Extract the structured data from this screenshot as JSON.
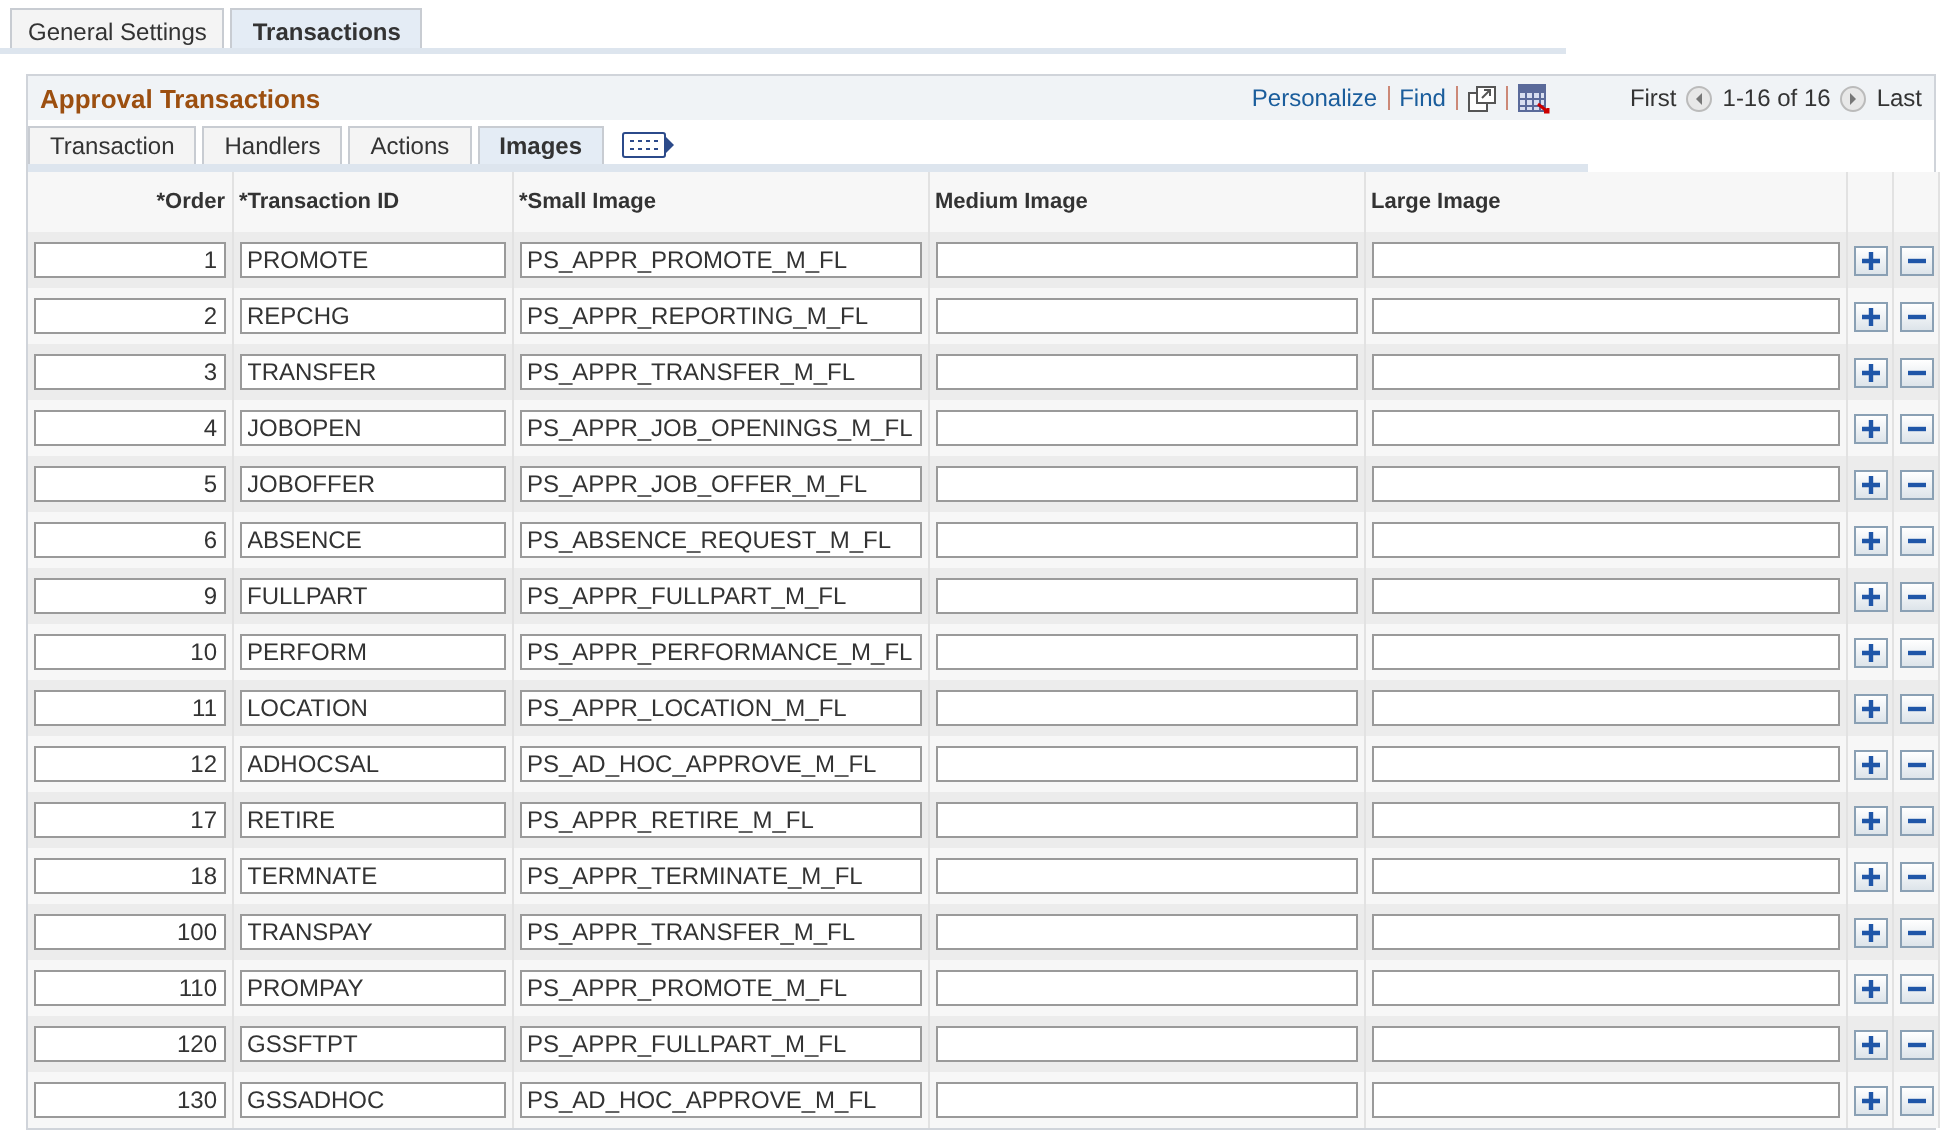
{
  "page_tabs": [
    {
      "label": "General Settings",
      "selected": false
    },
    {
      "label": "Transactions",
      "selected": true
    }
  ],
  "grid": {
    "title": "Approval Transactions",
    "toolbar": {
      "links": [
        "Personalize",
        "Find"
      ],
      "first": "First",
      "range": "1-16 of 16",
      "last": "Last"
    },
    "tabs": [
      {
        "label": "Transaction",
        "selected": false
      },
      {
        "label": "Handlers",
        "selected": false
      },
      {
        "label": "Actions",
        "selected": false
      },
      {
        "label": "Images",
        "selected": true
      }
    ],
    "columns": [
      "*Order",
      "*Transaction ID",
      "*Small Image",
      "Medium Image",
      "Large Image"
    ],
    "rows": [
      {
        "order": "1",
        "transaction_id": "PROMOTE",
        "small_image": "PS_APPR_PROMOTE_M_FL"
      },
      {
        "order": "2",
        "transaction_id": "REPCHG",
        "small_image": "PS_APPR_REPORTING_M_FL"
      },
      {
        "order": "3",
        "transaction_id": "TRANSFER",
        "small_image": "PS_APPR_TRANSFER_M_FL"
      },
      {
        "order": "4",
        "transaction_id": "JOBOPEN",
        "small_image": "PS_APPR_JOB_OPENINGS_M_FL"
      },
      {
        "order": "5",
        "transaction_id": "JOBOFFER",
        "small_image": "PS_APPR_JOB_OFFER_M_FL"
      },
      {
        "order": "6",
        "transaction_id": "ABSENCE",
        "small_image": "PS_ABSENCE_REQUEST_M_FL"
      },
      {
        "order": "9",
        "transaction_id": "FULLPART",
        "small_image": "PS_APPR_FULLPART_M_FL"
      },
      {
        "order": "10",
        "transaction_id": "PERFORM",
        "small_image": "PS_APPR_PERFORMANCE_M_FL"
      },
      {
        "order": "11",
        "transaction_id": "LOCATION",
        "small_image": "PS_APPR_LOCATION_M_FL"
      },
      {
        "order": "12",
        "transaction_id": "ADHOCSAL",
        "small_image": "PS_AD_HOC_APPROVE_M_FL"
      },
      {
        "order": "17",
        "transaction_id": "RETIRE",
        "small_image": "PS_APPR_RETIRE_M_FL"
      },
      {
        "order": "18",
        "transaction_id": "TERMNATE",
        "small_image": "PS_APPR_TERMINATE_M_FL"
      },
      {
        "order": "100",
        "transaction_id": "TRANSPAY",
        "small_image": "PS_APPR_TRANSFER_M_FL"
      },
      {
        "order": "110",
        "transaction_id": "PROMPAY",
        "small_image": "PS_APPR_PROMOTE_M_FL"
      },
      {
        "order": "120",
        "transaction_id": "GSSFTPT",
        "small_image": "PS_APPR_FULLPART_M_FL"
      },
      {
        "order": "130",
        "transaction_id": "GSSADHOC",
        "small_image": "PS_AD_HOC_APPROVE_M_FL"
      }
    ]
  }
}
